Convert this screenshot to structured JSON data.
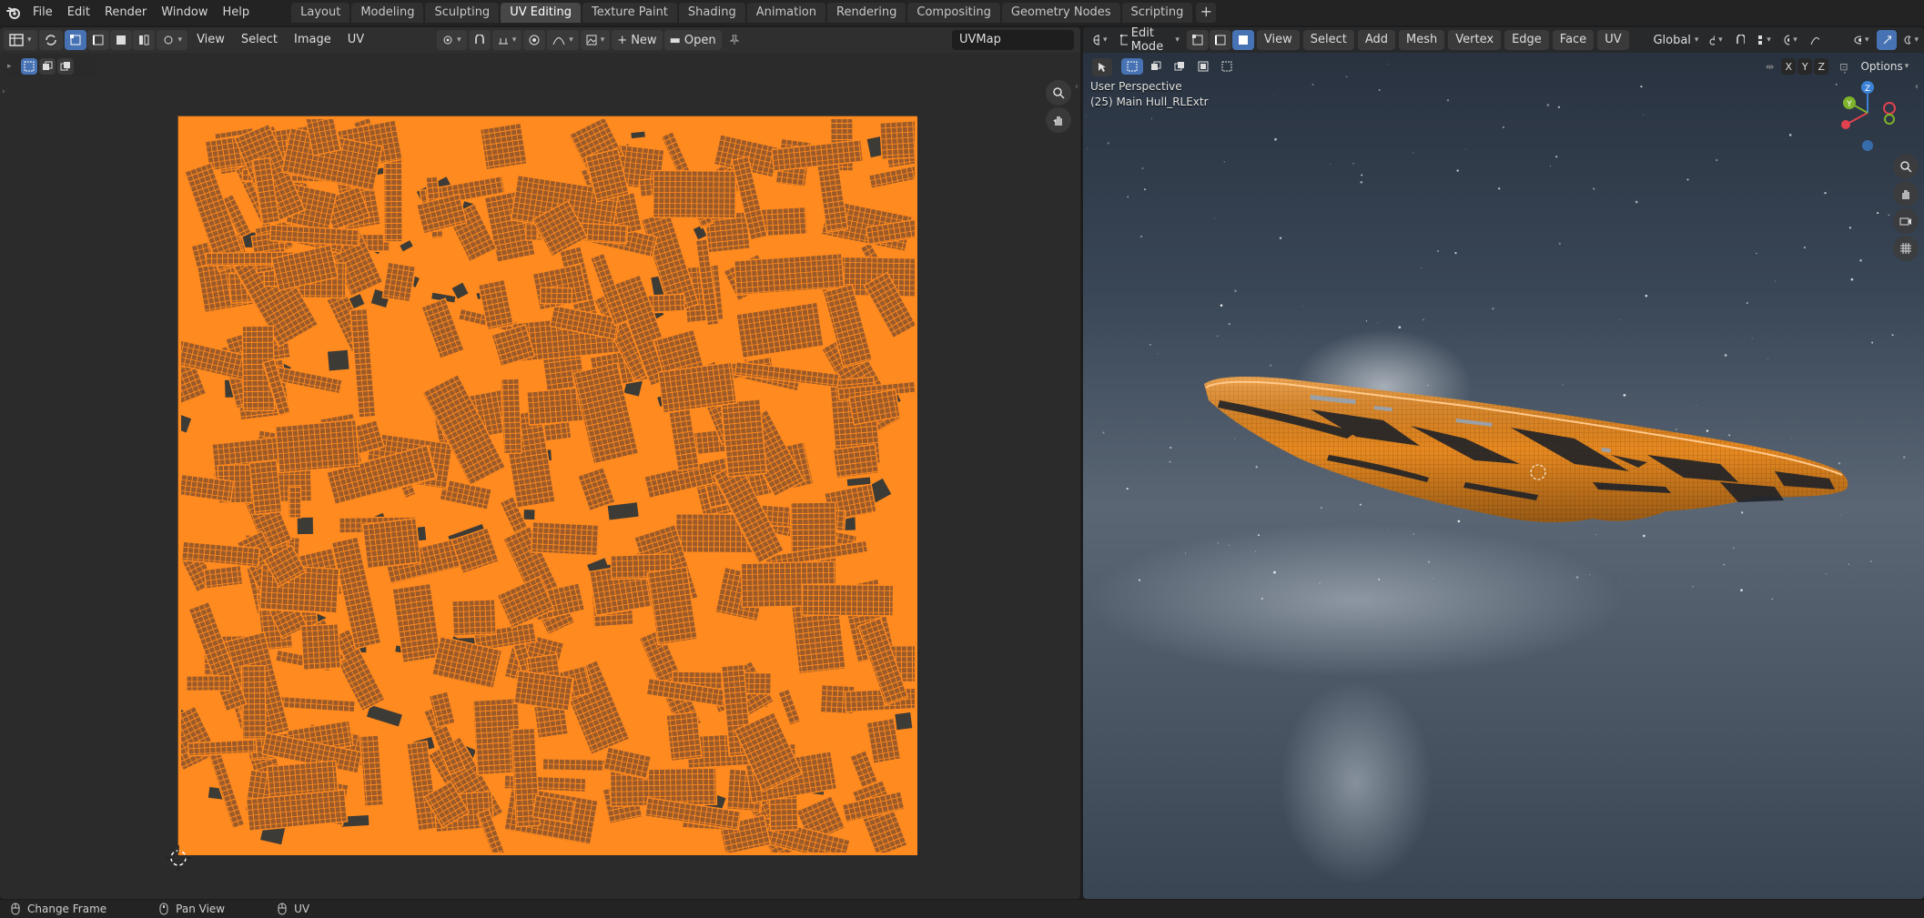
{
  "topbar": {
    "menus": [
      "File",
      "Edit",
      "Render",
      "Window",
      "Help"
    ],
    "workspaces": [
      "Layout",
      "Modeling",
      "Sculpting",
      "UV Editing",
      "Texture Paint",
      "Shading",
      "Animation",
      "Rendering",
      "Compositing",
      "Geometry Nodes",
      "Scripting"
    ],
    "active_workspace": "UV Editing",
    "add_tab": "+"
  },
  "uv_editor": {
    "menus": [
      "View",
      "Select",
      "Image",
      "UV"
    ],
    "new_label": "New",
    "open_label": "Open",
    "uvmap_field": "UVMap",
    "mesh_color": "#ff8a1f"
  },
  "viewport": {
    "mode": "Edit Mode",
    "menus": [
      "View",
      "Select",
      "Add",
      "Mesh",
      "Vertex",
      "Edge",
      "Face",
      "UV"
    ],
    "orientation": "Global",
    "axes": [
      "X",
      "Y",
      "Z"
    ],
    "options_label": "Options",
    "perspective": "User Perspective",
    "object_info": "(25) Main Hull_RLExtr",
    "gizmo_labels": {
      "x": "X",
      "y": "Y",
      "z": "Z"
    },
    "colors": {
      "x": "#e0414f",
      "y": "#7fb32a",
      "z": "#3b82d6"
    }
  },
  "statusbar": {
    "items": [
      "Change Frame",
      "Pan View",
      "UV"
    ]
  }
}
